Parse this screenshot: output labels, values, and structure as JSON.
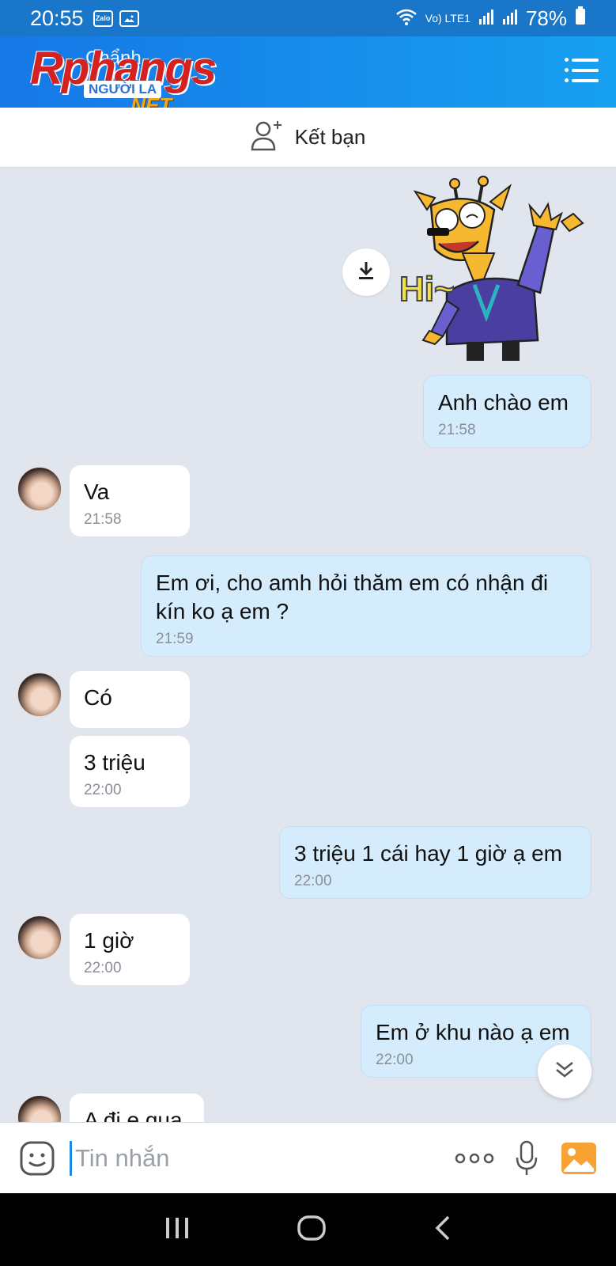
{
  "status_bar": {
    "time": "20:55",
    "app_icon_label": "Zalo",
    "network_label": "Vo) LTE1",
    "battery_percent": "78%"
  },
  "header": {
    "title_behind": "Chẩnh",
    "watermark_main": "Rphangs",
    "watermark_badge": "NGƯỜI LA",
    "watermark_net": ".NET"
  },
  "add_friend": {
    "label": "Kết bạn"
  },
  "sticker": {
    "text": "Hi~"
  },
  "messages": [
    {
      "dir": "out",
      "text": "Anh chào em",
      "time": "21:58"
    },
    {
      "dir": "in",
      "text": "Va",
      "time": "21:58"
    },
    {
      "dir": "out",
      "text": "Em ơi, cho amh hỏi thăm em có nhận đi kín ko ạ em ?",
      "time": "21:59"
    },
    {
      "dir": "in",
      "text": "Có",
      "time": ""
    },
    {
      "dir": "in",
      "text": "3 triệu",
      "time": "22:00"
    },
    {
      "dir": "out",
      "text": "3 triệu 1 cái hay 1 giờ ạ em",
      "time": "22:00"
    },
    {
      "dir": "in",
      "text": "1 giờ",
      "time": "22:00"
    },
    {
      "dir": "out",
      "text": "Em ở khu nào ạ em",
      "time": "22:00"
    },
    {
      "dir": "in",
      "text": "A đi e qua",
      "time": ""
    }
  ],
  "input": {
    "placeholder": "Tin nhắn"
  },
  "colors": {
    "header": "#1677e6",
    "outgoing_bubble": "#d5ecfd",
    "incoming_bubble": "#ffffff",
    "chat_background": "#e1e6ee"
  }
}
